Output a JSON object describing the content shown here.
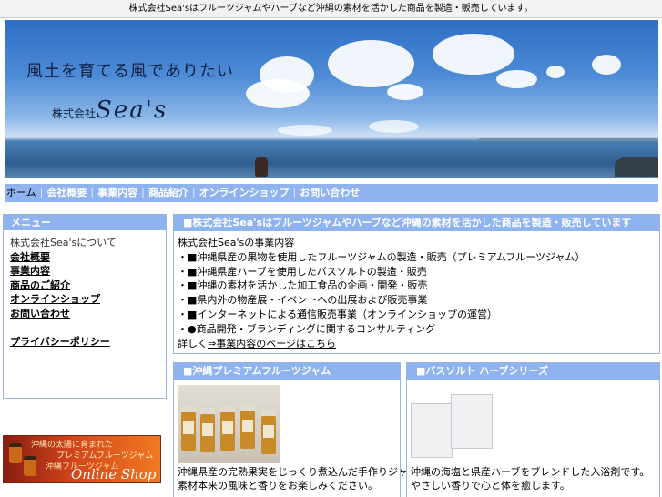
{
  "topbar": {
    "text": "株式会社Sea'sはフルーツジャムやハーブなど沖縄の素材を活かした商品を製造・販売しています。"
  },
  "hero": {
    "slogan": "風土を育てる風でありたい",
    "company_prefix": "株式会社",
    "company_logo": "Sea's"
  },
  "nav": {
    "items": [
      "ホーム",
      "会社概要",
      "事業内容",
      "商品紹介",
      "オンラインショップ",
      "お問い合わせ"
    ]
  },
  "sidebar": {
    "title": "メニュー",
    "items": [
      "株式会社Sea'sについて",
      "会社概要",
      "事業内容",
      "商品のご紹介",
      "オンラインショップ",
      "お問い合わせ",
      "",
      "プライバシーポリシー"
    ]
  },
  "banner": {
    "line1": "沖縄の太陽に育まれた",
    "line2": "プレミアムフルーツジャム",
    "line3": "沖縄フルーツジャム",
    "line4": "Online Shop"
  },
  "main": {
    "title": "■株式会社Sea'sはフルーツジャムやハーブなど沖縄の素材を活かした商品を製造・販売しています",
    "lines": [
      "株式会社Sea'sの事業内容",
      "・■沖縄県産の果物を使用したフルーツジャムの製造・販売（プレミアムフルーツジャム）",
      "・■沖縄県産ハーブを使用したバスソルトの製造・販売",
      "・■沖縄の素材を活かした加工食品の企画・開発・販売",
      "・■県内外の物産展・イベントへの出展および販売事業",
      "・■インターネットによる通信販売事業（オンラインショップの運営）",
      "・●商品開発・ブランディングに関するコンサルティング"
    ],
    "link_prefix": "詳しく",
    "link_text": "⇒事業内容のページはこちら"
  },
  "products": [
    {
      "title": "■沖縄プレミアムフルーツジャム",
      "desc": [
        "沖縄県産の完熟果実をじっくり煮込んだ手作りジャムです。",
        "素材本来の風味と香りをお楽しみください。"
      ]
    },
    {
      "title": "■バスソルト ハーブシリーズ",
      "desc": [
        "沖縄の海塩と県産ハーブをブレンドした入浴剤です。",
        "やさしい香りで心と体を癒します。"
      ]
    }
  ],
  "colors": {
    "accent": "#8fb3ee",
    "border": "#99b3dd"
  }
}
